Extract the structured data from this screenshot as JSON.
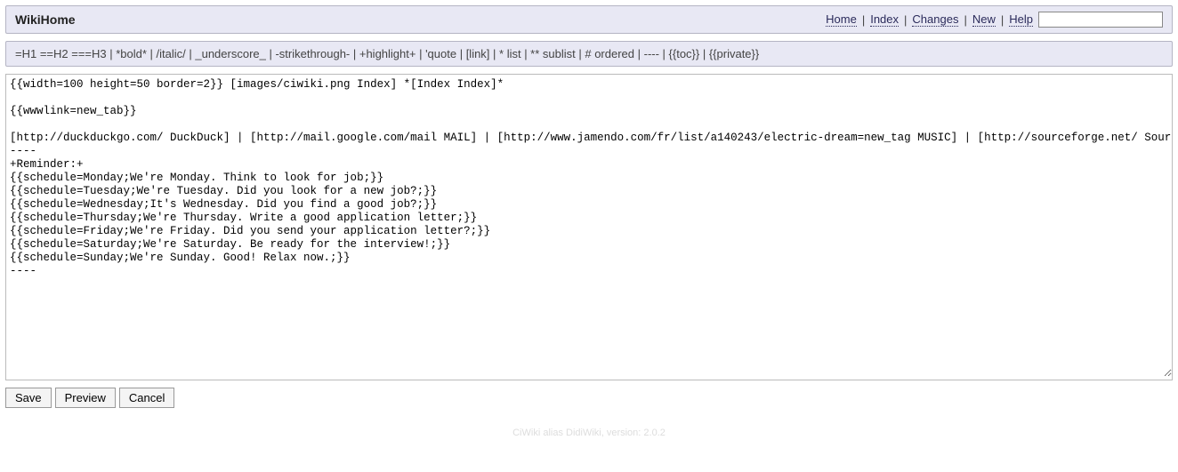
{
  "header": {
    "title": "WikiHome",
    "nav": {
      "home": "Home",
      "index": "Index",
      "changes": "Changes",
      "new": "New",
      "help": "Help",
      "sep": "|"
    },
    "search_value": ""
  },
  "syntax_help": "=H1 ==H2 ===H3 | *bold* | /italic/ | _underscore_ | -strikethrough- | +highlight+ | 'quote | [link] | * list | ** sublist | # ordered | ---- | {{toc}} | {{private}}",
  "editor_content": "{{width=100 height=50 border=2}} [images/ciwiki.png Index] *[Index Index]*\n\n{{wwwlink=new_tab}}\n\n[http://duckduckgo.com/ DuckDuck] | [http://mail.google.com/mail MAIL] | [http://www.jamendo.com/fr/list/a140243/electric-dream=new_tag MUSIC] | [http://sourceforge.net/ SourceForge]\n----\n+Reminder:+\n{{schedule=Monday;We're Monday. Think to look for job;}}\n{{schedule=Tuesday;We're Tuesday. Did you look for a new job?;}}\n{{schedule=Wednesday;It's Wednesday. Did you find a good job?;}}\n{{schedule=Thursday;We're Thursday. Write a good application letter;}}\n{{schedule=Friday;We're Friday. Did you send your application letter?;}}\n{{schedule=Saturday;We're Saturday. Be ready for the interview!;}}\n{{schedule=Sunday;We're Sunday. Good! Relax now.;}}\n----",
  "buttons": {
    "save": "Save",
    "preview": "Preview",
    "cancel": "Cancel"
  },
  "footer": "CiWiki alias DidiWiki, version: 2.0.2"
}
